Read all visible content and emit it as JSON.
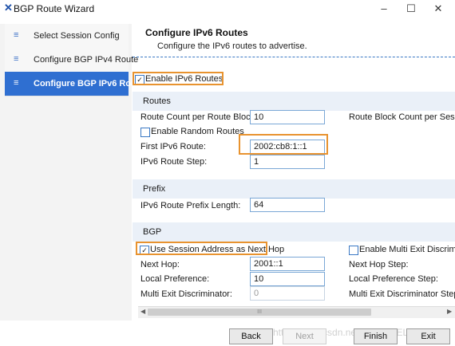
{
  "window": {
    "title": "BGP Route Wizard",
    "icon": "x-logo-icon",
    "minimize": "–",
    "maximize": "☐",
    "close": "✕"
  },
  "sidebar": {
    "items": [
      {
        "label": "Select Session Config",
        "icon": "≡"
      },
      {
        "label": "Configure BGP IPv4 Route",
        "icon": "≡"
      },
      {
        "label": "Configure BGP IPv6 Route",
        "icon": "≡"
      }
    ]
  },
  "header": {
    "title": "Configure IPv6 Routes",
    "subtitle": "Configure the IPv6 routes to advertise."
  },
  "content": {
    "enable_ipv6": {
      "label": "Enable IPv6 Routes",
      "checked": true
    },
    "routes": {
      "title": "Routes",
      "route_count_label": "Route Count per Route Block:",
      "route_count_value": "10",
      "route_block_count_label": "Route Block Count per Session:",
      "enable_random_label": "Enable Random Routes",
      "first_ipv6_label": "First IPv6 Route:",
      "first_ipv6_value": "2002:cb8:1::1",
      "step_label": "IPv6 Route Step:",
      "step_value": "1"
    },
    "prefix": {
      "title": "Prefix",
      "length_label": "IPv6 Route Prefix Length:",
      "length_value": "64"
    },
    "bgp": {
      "title": "BGP",
      "use_session_label": "Use Session Address as Next Hop",
      "use_session_checked": true,
      "enable_med_label": "Enable Multi Exit Discriminator",
      "next_hop_label": "Next Hop:",
      "next_hop_value": "2001::1",
      "next_hop_step_label": "Next Hop Step:",
      "local_pref_label": "Local Preference:",
      "local_pref_value": "10",
      "local_pref_step_label": "Local Preference Step:",
      "med_label": "Multi Exit Discriminator:",
      "med_value": "0",
      "med_step_label": "Multi Exit Discriminator Step:"
    }
  },
  "scrollbar": {
    "left_arrow": "◀",
    "right_arrow": "▶",
    "thumb_grip": "III"
  },
  "buttons": {
    "back": "Back",
    "next": "Next",
    "finish": "Finish",
    "exit": "Exit"
  },
  "watermark": "https://blog.csdn.net/XINERTEL",
  "colors": {
    "accent": "#2f6fd1",
    "highlight": "#e8932f",
    "section_bg": "#eaf0f8"
  }
}
